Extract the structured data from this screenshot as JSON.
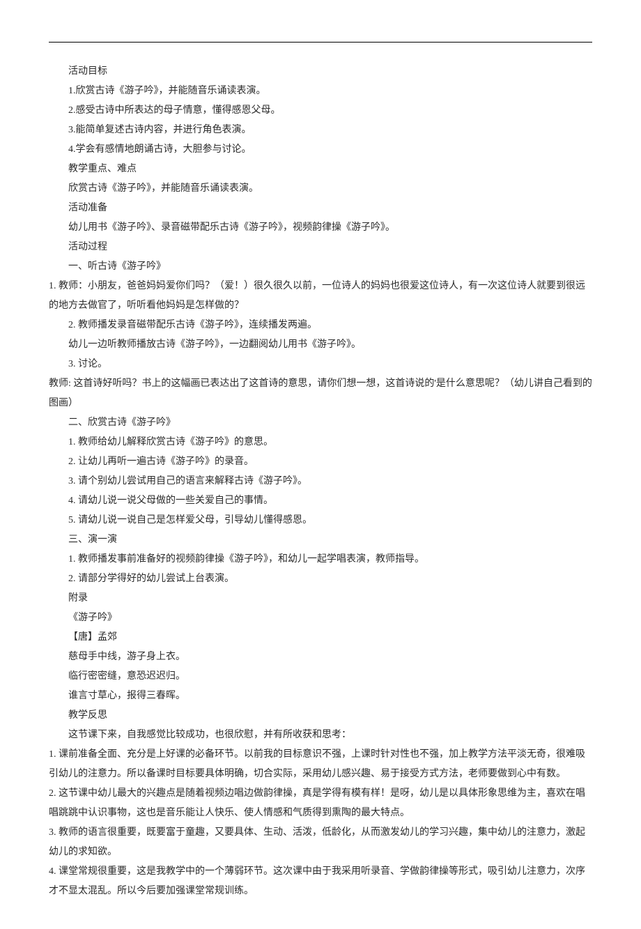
{
  "lines": [
    "活动目标",
    "1.欣赏古诗《游子吟》，并能随音乐诵读表演。",
    "2.感受古诗中所表达的母子情意，懂得感恩父母。",
    "3.能简单复述古诗内容，并进行角色表演。",
    "4.学会有感情地朗诵古诗，大胆参与讨论。",
    "教学重点、难点",
    "欣赏古诗《游子吟》，并能随音乐诵读表演。",
    "活动准备",
    "幼儿用书《游子吟》、录音磁带配乐古诗《游子吟》，视频韵律操《游子吟》。",
    "活动过程",
    "一、听古诗《游子吟》",
    "1. 教师：小朋友，爸爸妈妈爱你们吗？（爱！）很久很久以前，一位诗人的妈妈也很爱这位诗人，有一次这位诗人就要到很远的地方去做官了，听听看他妈妈是怎样做的？",
    "2. 教师播发录音磁带配乐古诗《游子吟》，连续播发两遍。",
    "幼儿一边听教师播放古诗《游子吟》，一边翻阅幼儿用书《游子吟》。",
    "3. 讨论。",
    "教师: 这首诗好听吗？书上的这幅画已表达出了这首诗的意思，请你们想一想，这首诗说的'是什么意思呢？（幼儿讲自己看到的图画）",
    "二、欣赏古诗《游子吟》",
    "1. 教师给幼儿解释欣赏古诗《游子吟》的意思。",
    "2. 让幼儿再听一遍古诗《游子吟》的录音。",
    "3. 请个别幼儿尝试用自己的语言来解释古诗《游子吟》。",
    "4. 请幼儿说一说父母做的一些关爱自己的事情。",
    "5. 请幼儿说一说自己是怎样爱父母，引导幼儿懂得感恩。",
    "三、演一演",
    "1. 教师播发事前准备好的视频韵律操《游子吟》，和幼儿一起学唱表演，教师指导。",
    "2. 请部分学得好的幼儿尝试上台表演。",
    "附录",
    "《游子吟》",
    "【唐】孟郊",
    "慈母手中线，游子身上衣。",
    "临行密密缝，意恐迟迟归。",
    "谁言寸草心，报得三春晖。",
    "教学反思",
    "这节课下来，自我感觉比较成功，也很欣慰，并有所收获和思考：",
    "1. 课前准备全面、充分是上好课的必备环节。以前我的目标意识不强，上课时针对性也不强，加上教学方法平淡无奇，很难吸引幼儿的注意力。所以备课时目标要具体明确，切合实际，采用幼儿感兴趣、易于接受方式方法，老师要做到心中有数。",
    "2. 这节课中幼儿最大的兴趣点是随着视频边唱边做韵律操，真是学得有模有样！是呀，幼儿是以具体形象思维为主，喜欢在唱唱跳跳中认识事物，这也是音乐能让人快乐、使人情感和气质得到熏陶的最大特点。",
    "3. 教师的语言很重要，既要富于童趣，又要具体、生动、活泼，低龄化，从而激发幼儿的学习兴趣，集中幼儿的注意力，激起幼儿的求知欲。",
    "4. 课堂常规很重要，这是我教学中的一个薄弱环节。这次课中由于我采用听录音、学做韵律操等形式，吸引幼儿注意力，次序才不显太混乱。所以今后要加强课堂常规训练。"
  ],
  "wrap_no_indent_indices": [
    11,
    15,
    33,
    34,
    35,
    36
  ]
}
